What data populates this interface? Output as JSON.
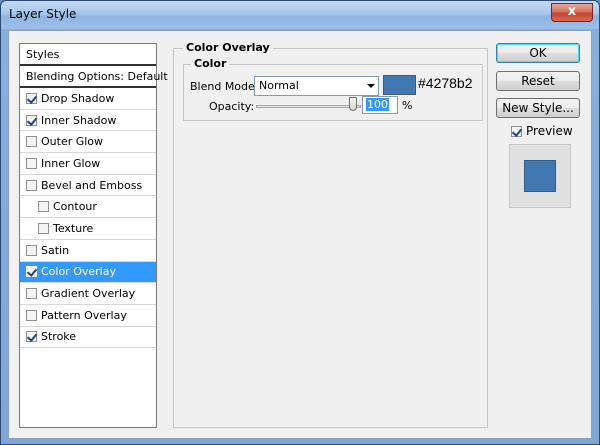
{
  "window": {
    "title": "Layer Style",
    "close_glyph": "x"
  },
  "styles_panel": {
    "header": "Styles",
    "blending_options": "Blending Options: Default",
    "items": [
      {
        "label": "Drop Shadow",
        "checked": true
      },
      {
        "label": "Inner Shadow",
        "checked": true
      },
      {
        "label": "Outer Glow",
        "checked": false
      },
      {
        "label": "Inner Glow",
        "checked": false
      },
      {
        "label": "Bevel and Emboss",
        "checked": false
      },
      {
        "label": "Contour",
        "checked": false
      },
      {
        "label": "Texture",
        "checked": false
      },
      {
        "label": "Satin",
        "checked": false
      },
      {
        "label": "Color Overlay",
        "checked": true,
        "selected": true
      },
      {
        "label": "Gradient Overlay",
        "checked": false
      },
      {
        "label": "Pattern Overlay",
        "checked": false
      },
      {
        "label": "Stroke",
        "checked": true
      }
    ]
  },
  "color_overlay": {
    "group_title": "Color Overlay",
    "sub_title": "Color",
    "blend_mode_label": "Blend Mode:",
    "blend_mode_value": "Normal",
    "color_hex_label": "#4278b2",
    "color": "#4278b2",
    "opacity_label": "Opacity:",
    "opacity_value": "100",
    "opacity_unit": "%"
  },
  "buttons": {
    "ok": "OK",
    "reset": "Reset",
    "new_style": "New Style..."
  },
  "preview": {
    "label": "Preview",
    "checked": true,
    "swatch_color": "#4278b2"
  },
  "colors": {
    "selection": "#3399ff",
    "client_bg": "#f0f0f0"
  }
}
